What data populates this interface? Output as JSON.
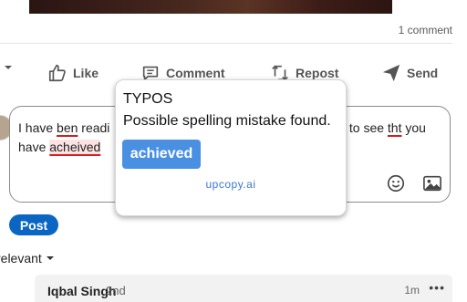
{
  "post": {
    "comment_count": "1 comment"
  },
  "actions": {
    "like": "Like",
    "comment": "Comment",
    "repost": "Repost",
    "send": "Send"
  },
  "editor": {
    "segments": {
      "seg1": "I have ",
      "typo1": "ben",
      "seg2": " readi",
      "seg3": "y to see ",
      "typo2": "tht",
      "seg4": " you",
      "seg5": "have ",
      "typo3": "acheived"
    },
    "icons": {
      "emoji": "smiley-icon",
      "image": "image-icon"
    }
  },
  "post_button": "Post",
  "sort": {
    "label": "relevant"
  },
  "reply": {
    "name": "Iqbal Singh",
    "age": "2nd",
    "time": "1m",
    "more": "•••"
  },
  "popup": {
    "title": "TYPOS",
    "message": "Possible spelling mistake found.",
    "suggestion": "achieved",
    "brand": "upcopy.ai"
  },
  "colors": {
    "accent": "#0a66c2",
    "suggestion": "#4a90e2",
    "spelling_underline": "#d21f1f",
    "brand": "#3b78d8"
  }
}
